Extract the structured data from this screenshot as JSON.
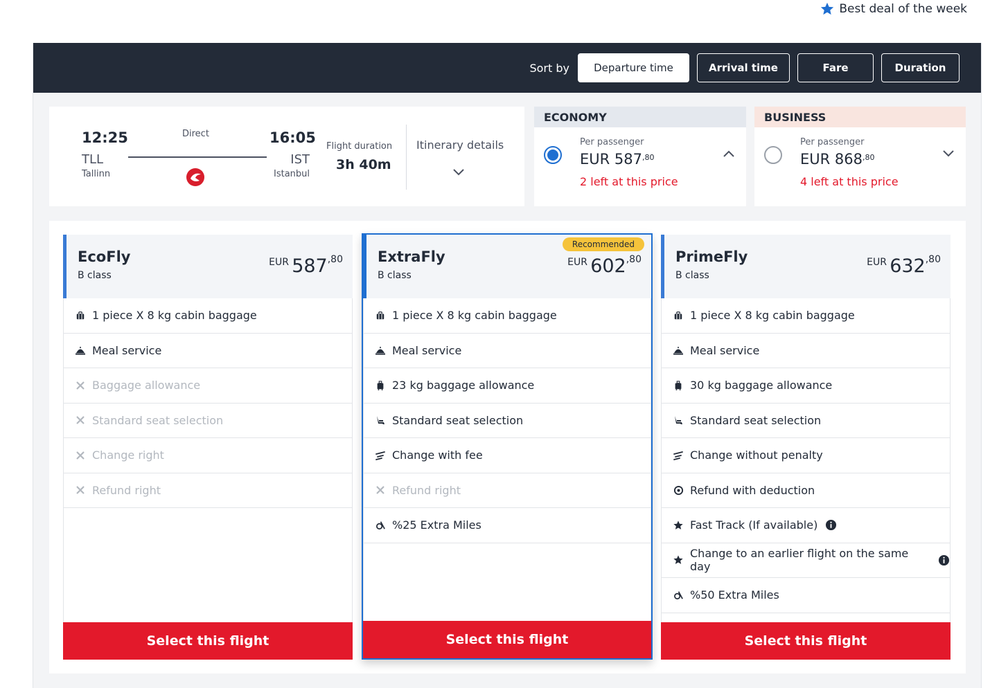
{
  "best_deal": {
    "label": "Best deal of the week",
    "icon": "star-icon",
    "icon_color": "#1f6fd1"
  },
  "sort": {
    "label": "Sort by",
    "options": [
      "Departure time",
      "Arrival time",
      "Fare",
      "Duration"
    ],
    "selected": "Departure time"
  },
  "flight": {
    "departure": {
      "time": "12:25",
      "code": "TLL",
      "city": "Tallinn"
    },
    "arrival": {
      "time": "16:05",
      "code": "IST",
      "city": "Istanbul"
    },
    "stops": "Direct",
    "airline_logo": "turkish-airlines-logo-icon",
    "duration_label": "Flight duration",
    "duration": "3h 40m",
    "itinerary_label": "Itinerary details"
  },
  "cabins": [
    {
      "name": "ECONOMY",
      "per_passenger": "Per passenger",
      "currency": "EUR",
      "price_main": "587",
      "price_cents": ",80",
      "availability": "2 left at this price",
      "selected": true,
      "expanded": true
    },
    {
      "name": "BUSINESS",
      "per_passenger": "Per passenger",
      "currency": "EUR",
      "price_main": "868",
      "price_cents": ",80",
      "availability": "4 left at this price",
      "selected": false,
      "expanded": false
    }
  ],
  "fares": [
    {
      "name": "EcoFly",
      "class": "B class",
      "currency": "EUR",
      "price_main": "587",
      "price_cents": ",80",
      "badge": "",
      "features": [
        {
          "icon": "cabin-bag-icon",
          "text": "1 piece X 8 kg cabin baggage",
          "included": true
        },
        {
          "icon": "meal-icon",
          "text": "Meal service",
          "included": true
        },
        {
          "icon": "cross-icon",
          "text": "Baggage allowance",
          "included": false
        },
        {
          "icon": "cross-icon",
          "text": "Standard seat selection",
          "included": false
        },
        {
          "icon": "cross-icon",
          "text": "Change right",
          "included": false
        },
        {
          "icon": "cross-icon",
          "text": "Refund right",
          "included": false
        }
      ],
      "select_label": "Select this flight"
    },
    {
      "name": "ExtraFly",
      "class": "B class",
      "currency": "EUR",
      "price_main": "602",
      "price_cents": ",80",
      "badge": "Recommended",
      "features": [
        {
          "icon": "cabin-bag-icon",
          "text": "1 piece X 8 kg cabin baggage",
          "included": true
        },
        {
          "icon": "meal-icon",
          "text": "Meal service",
          "included": true
        },
        {
          "icon": "luggage-icon",
          "text": "23 kg baggage allowance",
          "included": true
        },
        {
          "icon": "seat-icon",
          "text": "Standard seat selection",
          "included": true
        },
        {
          "icon": "change-icon",
          "text": "Change with fee",
          "included": true
        },
        {
          "icon": "cross-icon",
          "text": "Refund right",
          "included": false
        },
        {
          "icon": "miles-icon",
          "text": "%25 Extra Miles",
          "included": true
        }
      ],
      "select_label": "Select this flight"
    },
    {
      "name": "PrimeFly",
      "class": "B class",
      "currency": "EUR",
      "price_main": "632",
      "price_cents": ",80",
      "badge": "",
      "features": [
        {
          "icon": "cabin-bag-icon",
          "text": "1 piece X 8 kg cabin baggage",
          "included": true
        },
        {
          "icon": "meal-icon",
          "text": "Meal service",
          "included": true
        },
        {
          "icon": "luggage-icon",
          "text": "30 kg baggage allowance",
          "included": true
        },
        {
          "icon": "seat-icon",
          "text": "Standard seat selection",
          "included": true
        },
        {
          "icon": "change-icon",
          "text": "Change without penalty",
          "included": true
        },
        {
          "icon": "refund-icon",
          "text": "Refund with deduction",
          "included": true
        },
        {
          "icon": "star-icon",
          "text": "Fast Track (If available)",
          "included": true,
          "info": true
        },
        {
          "icon": "star-icon",
          "text": "Change to an earlier flight on the same day",
          "included": true,
          "info": true
        },
        {
          "icon": "miles-icon",
          "text": "%50 Extra Miles",
          "included": true
        }
      ],
      "select_label": "Select this flight"
    }
  ],
  "colors": {
    "header_bg": "#232b38",
    "accent_red": "#e3192b",
    "accent_blue": "#1f6fd1",
    "badge_yellow": "#f5c33b"
  }
}
